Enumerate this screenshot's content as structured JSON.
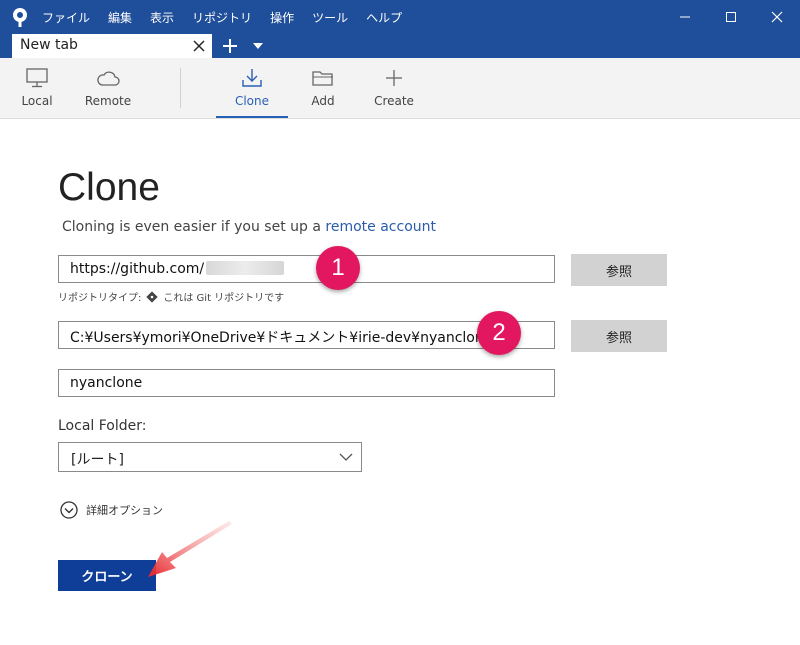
{
  "menu": [
    "ファイル",
    "編集",
    "表示",
    "リポジトリ",
    "操作",
    "ツール",
    "ヘルプ"
  ],
  "tab": {
    "label": "New tab"
  },
  "toolbar": {
    "local": "Local",
    "remote": "Remote",
    "clone": "Clone",
    "add": "Add",
    "create": "Create"
  },
  "page": {
    "title": "Clone",
    "subtitle": "Cloning is even easier if you set up a",
    "subtitle_link": "remote account"
  },
  "form": {
    "url_value": "https://github.com/",
    "browse_label": "参照",
    "repo_type_label": "リポジトリタイプ:",
    "repo_type_value": "これは Git リポジトリです",
    "path_value": "C:¥Users¥ymori¥OneDrive¥ドキュメント¥irie-dev¥nyanclone",
    "name_value": "nyanclone",
    "local_folder_label": "Local Folder:",
    "local_folder_value": "[ルート]",
    "advanced_label": "詳細オプション",
    "clone_button": "クローン"
  },
  "annotations": {
    "badge1": "1",
    "badge2": "2"
  },
  "colors": {
    "titlebar": "#1f4e9b",
    "accent": "#2a60b4",
    "primary_button": "#0e3e98",
    "badge": "#e2175f",
    "arrow": "#e8262b"
  }
}
